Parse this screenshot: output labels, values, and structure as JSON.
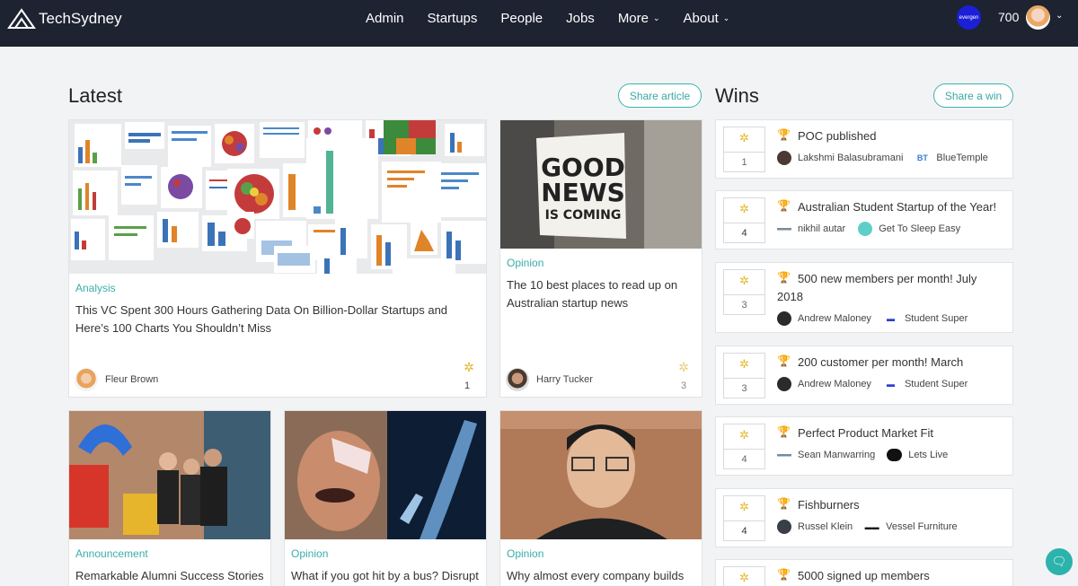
{
  "nav": {
    "logo_text": "TechSydney",
    "links": [
      "Admin",
      "Startups",
      "People",
      "Jobs",
      "More",
      "About"
    ],
    "org_badge": "evergen",
    "points": "700"
  },
  "latest": {
    "title": "Latest",
    "share_label": "Share article"
  },
  "wins": {
    "title": "Wins",
    "share_label": "Share a win"
  },
  "articles": [
    {
      "category": "Analysis",
      "title": "This VC Spent 300 Hours Gathering Data On Billion-Dollar Startups and Here’s 100 Charts You Shouldn’t Miss",
      "author": "Fleur Brown",
      "claps": "1"
    },
    {
      "category": "Opinion",
      "title": "The 10 best places to read up on Australian startup news",
      "author": "Harry Tucker",
      "claps": "3",
      "image_text": [
        "GOOD",
        "NEWS",
        "IS COMING"
      ]
    },
    {
      "category": "Announcement",
      "title": "Remarkable Alumni Success Stories"
    },
    {
      "category": "Opinion",
      "title": "What if you got hit by a bus? Disrupt"
    },
    {
      "category": "Opinion",
      "title": "Why almost every company builds"
    }
  ],
  "win_items": [
    {
      "title": "POC published",
      "person": "Lakshmi Balasubramani",
      "org": "BlueTemple",
      "claps": "1"
    },
    {
      "title": "Australian Student Startup of the Year!",
      "person": "nikhil autar",
      "org": "Get To Sleep Easy",
      "claps": "4"
    },
    {
      "title": "500 new members per month! July 2018",
      "person": "Andrew Maloney",
      "org": "Student Super",
      "claps": "3"
    },
    {
      "title": "200 customer per month! March",
      "person": "Andrew Maloney",
      "org": "Student Super",
      "claps": "3"
    },
    {
      "title": "Perfect Product Market Fit",
      "person": "Sean Manwarring",
      "org": "Lets Live",
      "claps": "4"
    },
    {
      "title": "Fishburners",
      "person": "Russel Klein",
      "org": "Vessel Furniture",
      "claps": "4"
    },
    {
      "title": "5000 signed up members",
      "person": "",
      "org": "",
      "claps": ""
    }
  ],
  "icons": {
    "clap": "clapping-hands-icon",
    "trophy": "trophy-icon",
    "chat": "chat-bubbles-icon",
    "logo": "mountain-logo-icon"
  },
  "colors": {
    "nav_bg": "#1d2330",
    "accent": "#3bb3ad",
    "trophy": "#e4b82a",
    "org_badge": "#1b1fd6"
  }
}
